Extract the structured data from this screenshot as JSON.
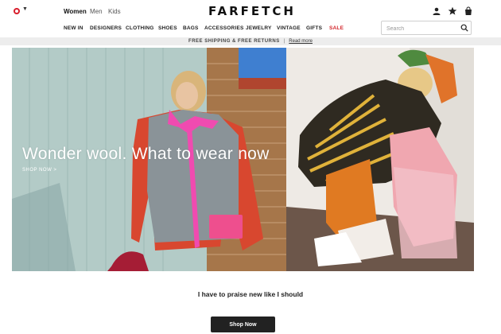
{
  "header": {
    "country_flag_icon": "flag-icon",
    "genders": [
      "Women",
      "Men",
      "Kids"
    ],
    "logo": "FARFETCH",
    "icons": [
      "account-icon",
      "wishlist-star-icon",
      "bag-icon"
    ]
  },
  "nav": {
    "items": [
      "NEW IN",
      "DESIGNERS",
      "CLOTHING",
      "SHOES",
      "BAGS",
      "ACCESSORIES",
      "JEWELRY",
      "VINTAGE",
      "GIFTS",
      "SALE"
    ],
    "sale_color": "#d3262b"
  },
  "search": {
    "placeholder": "Search",
    "icon": "search-icon"
  },
  "promo": {
    "text": "FREE SHIPPING & FREE RETURNS",
    "link": "Read more"
  },
  "hero": {
    "title": "Wonder wool. What to wear now",
    "link": "SHOP NOW >"
  },
  "tagline": "I have to praise new like I should",
  "cta": "Shop Now"
}
